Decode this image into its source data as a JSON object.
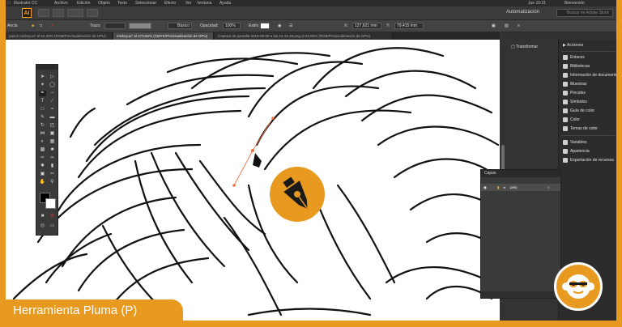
{
  "app": {
    "logo": "Ai",
    "menu": [
      "Illustrator CC",
      "Archivo",
      "Edición",
      "Objeto",
      "Texto",
      "Seleccionar",
      "Efecto",
      "Ver",
      "Ventana",
      "Ayuda"
    ],
    "status_right": "Jue 10:31",
    "user_right": "Bienvenido",
    "workspace": "Automatización",
    "search_placeholder": "Buscar en Adobe Stock"
  },
  "control_bar": {
    "selection_label": "Ancla",
    "stroke_label": "Trazo",
    "stroke_weight": "",
    "brush_label": "Básico",
    "opacity_label": "Opacidad:",
    "opacity_value": "100%",
    "style_label": "Estilo",
    "x_label": "X:",
    "x_value": "127,621 mm",
    "y_label": "Y:",
    "y_value": "79,415 mm"
  },
  "tabs": [
    {
      "label": "pasos mickey.ai* al 53,33% (RGB/Previsualización de GPU)",
      "active": false
    },
    {
      "label": "mickey.ai* al 273,56% (CMYK/Previsualización de GPU)",
      "active": true
    },
    {
      "label": "Captura de pantalla 2018-08-09 a las 16.19.28.png al 33,95% (RGB/Previsualización de GPU)",
      "active": false
    }
  ],
  "dock": {
    "transform_label": "Transformar",
    "actions_label": "Acciones",
    "items": [
      "Enlaces",
      "Bibliotecas",
      "Información de documento",
      "Muestras",
      "Pinceles",
      "Símbolos",
      "Guía de color",
      "Color",
      "Temas de color",
      "Variables",
      "Apariencia",
      "Exportación de recursos"
    ]
  },
  "layers": {
    "title": "Capas",
    "layer_name": "pelo"
  },
  "caption": {
    "title": "Herramienta Pluma (P)"
  },
  "colors": {
    "accent": "#e8991f",
    "canvas": "#ffffff",
    "ui_dark": "#323232",
    "path_highlight": "#f26f3b"
  },
  "icons": {
    "pen_tool": "pen-nib-icon",
    "brand": "monkey-logo-icon"
  }
}
